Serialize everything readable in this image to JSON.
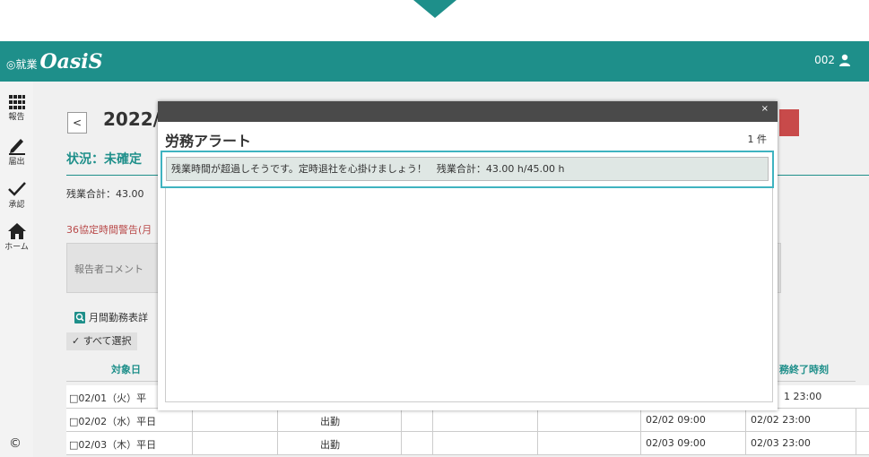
{
  "header": {
    "brand_mark": "◎就業",
    "logo": "OasiS",
    "user_id": "002"
  },
  "sidebar": {
    "items": [
      {
        "label": "報告",
        "icon": "grid-icon"
      },
      {
        "label": "届出",
        "icon": "pencil-icon"
      },
      {
        "label": "承認",
        "icon": "check-icon"
      },
      {
        "label": "ホーム",
        "icon": "home-icon"
      }
    ],
    "copyright": "©"
  },
  "page": {
    "prev": "<",
    "date_title": "2022/",
    "status": "状況：未確定",
    "overtime": "残業合計：43.00",
    "warning": "36協定時間警告(月",
    "comment_placeholder": "報告者コメント",
    "monthly_link": "月間勤務表詳",
    "select_all": "✓ すべて選択",
    "col_date": "対象日",
    "col_end": "務終了時刻",
    "rows": [
      {
        "date": "□02/01（火）平",
        "status": "",
        "start": "",
        "end": "1 23:00"
      },
      {
        "date": "□02/02（水）平日",
        "status": "出勤",
        "start": "02/02 09:00",
        "end": "02/02 23:00"
      },
      {
        "date": "□02/03（木）平日",
        "status": "出勤",
        "start": "02/03 09:00",
        "end": "02/03 23:00"
      }
    ]
  },
  "modal": {
    "close": "×",
    "title": "労務アラート",
    "count": "1 件",
    "alert_text": "残業時間が超過しそうです。定時退社を心掛けましょう！　残業合計：43.00 h/45.00 h"
  },
  "colors": {
    "brand": "#1e8f8a",
    "modal_bar": "#4a4a4a",
    "highlight": "#3fb3c0",
    "warning": "#b94a4a"
  }
}
